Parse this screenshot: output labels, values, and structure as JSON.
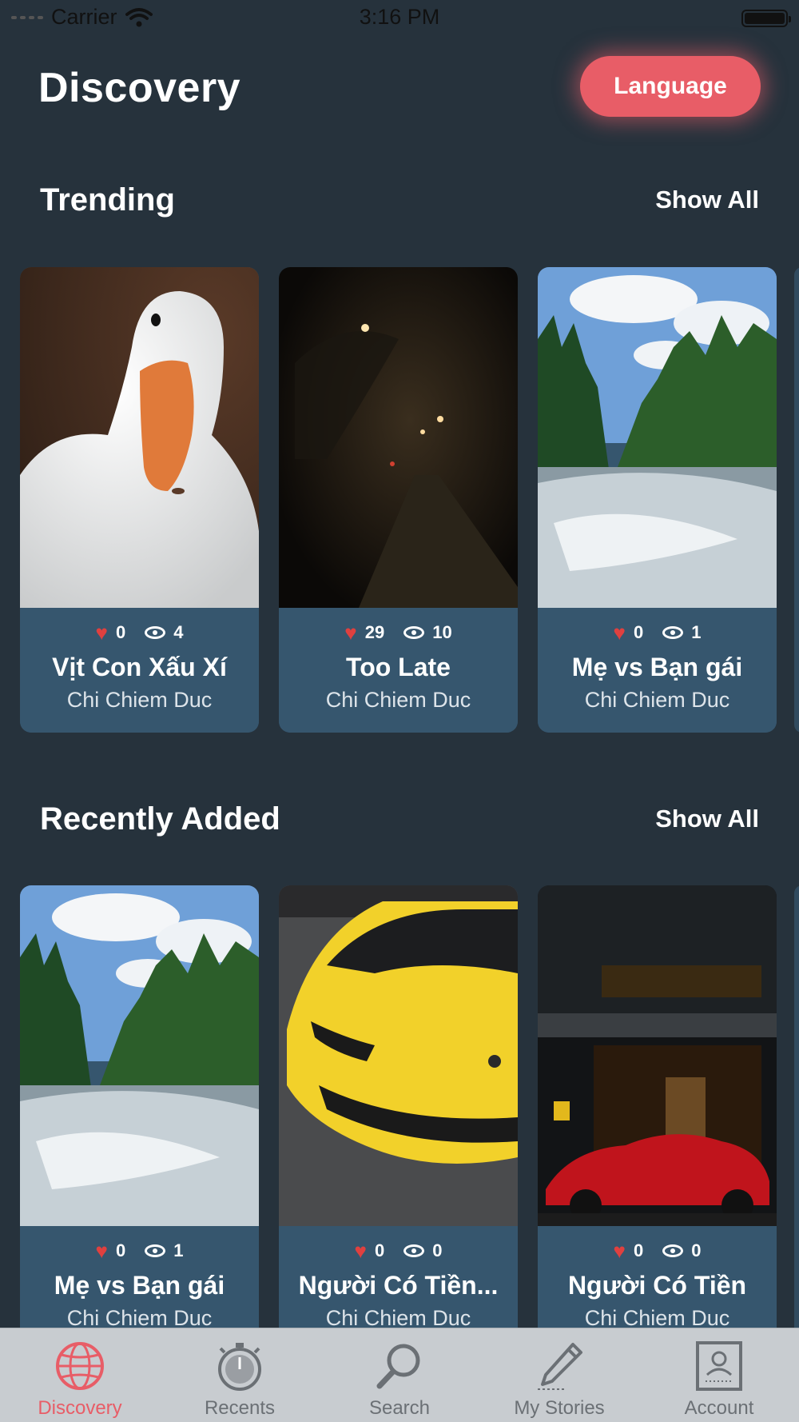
{
  "status_bar": {
    "carrier": "Carrier",
    "time": "3:16 PM"
  },
  "header": {
    "title": "Discovery",
    "language_label": "Language"
  },
  "colors": {
    "background": "#26323c",
    "card": "#36566e",
    "accent": "#e85d67",
    "heart": "#e0403f",
    "tab_bar": "#c8ccd0"
  },
  "trending": {
    "title": "Trending",
    "show_all": "Show All",
    "cards": [
      {
        "likes": "0",
        "views": "4",
        "title": "Vịt Con Xấu Xí",
        "author": "Chi Chiem Duc",
        "image": "duck"
      },
      {
        "likes": "29",
        "views": "10",
        "title": "Too Late",
        "author": "Chi Chiem Duc",
        "image": "night-road"
      },
      {
        "likes": "0",
        "views": "1",
        "title": "Mẹ vs Bạn gái",
        "author": "Chi Chiem Duc",
        "image": "river-forest"
      }
    ]
  },
  "recent": {
    "title": "Recently Added",
    "show_all": "Show All",
    "cards": [
      {
        "likes": "0",
        "views": "1",
        "title": "Mẹ vs Bạn gái",
        "author": "Chi Chiem Duc",
        "image": "river-forest"
      },
      {
        "likes": "0",
        "views": "0",
        "title": "Người Có Tiền...",
        "author": "Chi Chiem Duc",
        "image": "yellow-sports-car"
      },
      {
        "likes": "0",
        "views": "0",
        "title": "Người Có Tiền",
        "author": "Chi Chiem Duc",
        "image": "red-car-hotel"
      }
    ]
  },
  "tab_bar": {
    "items": [
      {
        "label": "Discovery",
        "icon": "globe-icon",
        "active": true
      },
      {
        "label": "Recents",
        "icon": "stopwatch-icon",
        "active": false
      },
      {
        "label": "Search",
        "icon": "magnifier-icon",
        "active": false
      },
      {
        "label": "My Stories",
        "icon": "pencil-icon",
        "active": false
      },
      {
        "label": "Account",
        "icon": "id-card-icon",
        "active": false
      }
    ]
  }
}
